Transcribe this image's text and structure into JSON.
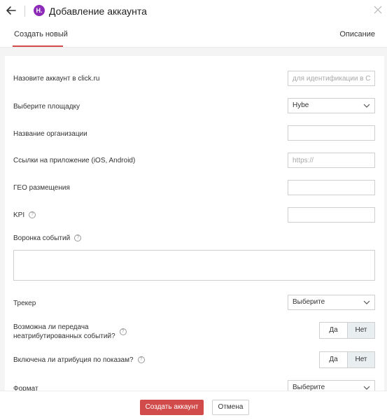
{
  "header": {
    "title": "Добавление аккаунта",
    "logo_letter": "H.",
    "back_icon": "arrow-left-icon",
    "close_icon": "close-icon"
  },
  "tabs": [
    {
      "label": "Создать новый",
      "active": true
    },
    {
      "label": "Описание",
      "active": false
    }
  ],
  "form": {
    "account_name": {
      "label": "Назовите аккаунт в click.ru",
      "placeholder": "для идентификации в Click"
    },
    "platform": {
      "label": "Выберите площадку",
      "value": "Hybe"
    },
    "org_name": {
      "label": "Название организации",
      "value": ""
    },
    "app_links": {
      "label": "Ссылки на приложение (iOS, Android)",
      "placeholder": "https://"
    },
    "geo": {
      "label": "ГЕО размещения",
      "value": ""
    },
    "kpi": {
      "label": "KPI",
      "help": "?",
      "value": ""
    },
    "funnel": {
      "label": "Воронка событий",
      "help": "?",
      "value": ""
    },
    "tracker": {
      "label": "Трекер",
      "value": "Выберите"
    },
    "unattributed": {
      "label_line1": "Возможна ли передача",
      "label_line2": "неатрибутированных событий?",
      "help": "?",
      "yes": "Да",
      "no": "Нет",
      "selected": "Нет"
    },
    "impression_attr": {
      "label": "Включена ли атрибуция по показам?",
      "help": "?",
      "yes": "Да",
      "no": "Нет",
      "selected": "Нет"
    },
    "format": {
      "label": "Формат",
      "value": "Выберите"
    }
  },
  "footer": {
    "submit_label": "Создать аккаунт",
    "cancel_label": "Отмена"
  },
  "colors": {
    "accent": "#d14b4b",
    "logo": "#8e2ab8"
  }
}
